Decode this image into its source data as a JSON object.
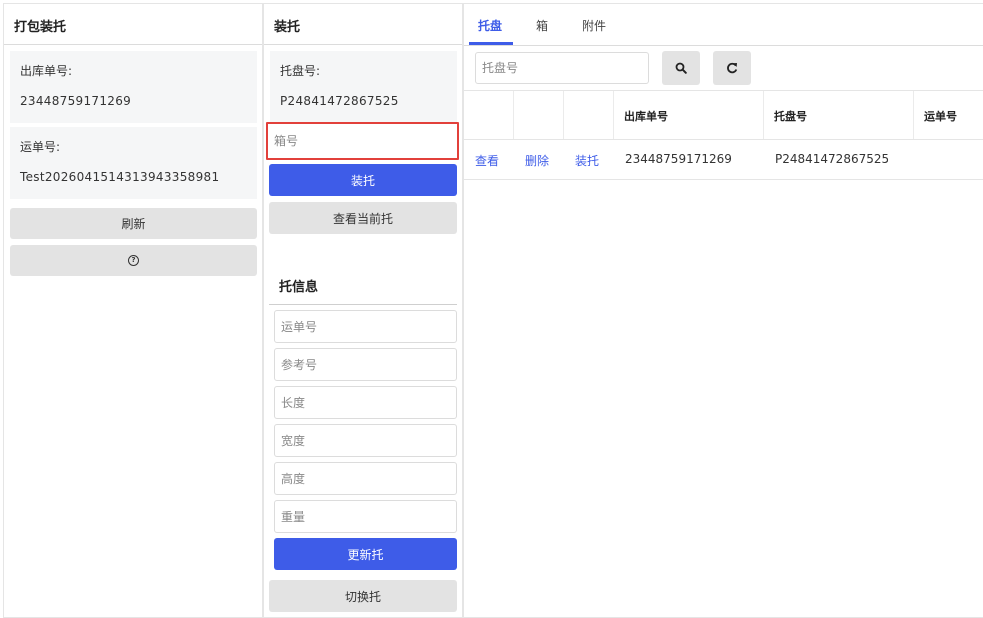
{
  "packing_panel": {
    "title": "打包装托",
    "outbound_label": "出库单号:",
    "outbound_value": "23448759171269",
    "waybill_label": "运单号:",
    "waybill_value": "Test20260415143139433589 81",
    "refresh_label": "刷新",
    "help_icon": "question-circle-icon"
  },
  "pallet_panel": {
    "title": "装托",
    "pallet_label": "托盘号:",
    "pallet_value": "P24841472867525",
    "box_placeholder": "箱号",
    "load_label": "装托",
    "view_current_label": "查看当前托",
    "info_title": "托信息",
    "fields": {
      "waybill": "运单号",
      "reference": "参考号",
      "length": "长度",
      "width": "宽度",
      "height": "高度",
      "weight": "重量"
    },
    "update_label": "更新托",
    "switch_label": "切换托",
    "highlight_color": "#e2403b"
  },
  "list_panel": {
    "tabs": [
      "托盘",
      "箱",
      "附件"
    ],
    "active_tab": "托盘",
    "search_placeholder": "托盘号",
    "search_icon": "search-icon",
    "refresh_icon": "refresh-icon",
    "columns": [
      "",
      "",
      "",
      "出库单号",
      "托盘号",
      "运单号"
    ],
    "rows": [
      {
        "view": "查看",
        "delete": "删除",
        "load": "装托",
        "outbound": "23448759171269",
        "pallet": "P24841472867525",
        "waybill": ""
      }
    ]
  },
  "colors": {
    "accent": "#3e5ce8",
    "button_gray": "#e3e3e3",
    "info_bg": "#f5f6f7"
  }
}
